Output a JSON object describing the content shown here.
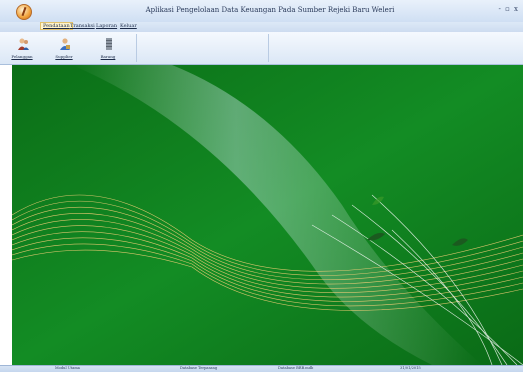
{
  "window": {
    "title": "Aplikasi Pengelolaan Data Keuangan Pada Sumber Rejeki Baru Weleri",
    "controls": "- ▫ x"
  },
  "menu": {
    "items": [
      {
        "label": "Pendataan",
        "active": true
      },
      {
        "label": "Transaksi",
        "active": false
      },
      {
        "label": "Laporan",
        "active": false
      },
      {
        "label": "Keluar",
        "active": false
      }
    ]
  },
  "ribbon": {
    "buttons": [
      {
        "label": "Pelanggan",
        "icon": "customer-icon"
      },
      {
        "label": "Supplier",
        "icon": "supplier-icon"
      },
      {
        "label": "Barang",
        "icon": "goods-icon"
      }
    ]
  },
  "statusbar": {
    "cells": [
      "Modul Utama",
      "Database Terpasang",
      "Database BRB.mdb",
      "31/01/2015"
    ]
  },
  "colors": {
    "workspace_background": "#0f7a1e",
    "ribbon_background": "#dbe7f6",
    "titlebar": "#cfdff3"
  }
}
